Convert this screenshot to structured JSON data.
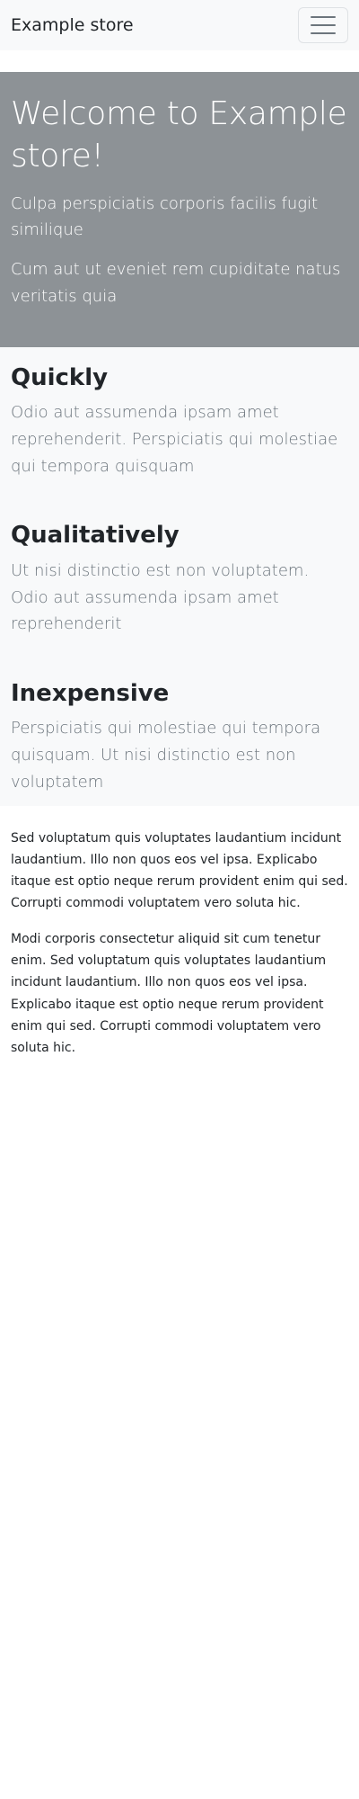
{
  "navbar": {
    "brand": "Example store",
    "toggle_icon": "hamburger-menu-icon"
  },
  "hero": {
    "title": "Welcome to Example store!",
    "paragraphs": [
      "Culpa perspiciatis corporis facilis fugit similique",
      "Cum aut ut eveniet rem cupiditate natus veritatis quia"
    ]
  },
  "features": [
    {
      "title": "Quickly",
      "text": "Odio aut assumenda ipsam amet reprehenderit. Perspiciatis qui molestiae qui tempora quisquam"
    },
    {
      "title": "Qualitatively",
      "text": "Ut nisi distinctio est non voluptatem. Odio aut assumenda ipsam amet reprehenderit"
    },
    {
      "title": "Inexpensive",
      "text": "Perspiciatis qui molestiae qui tempora quisquam. Ut nisi distinctio est non voluptatem"
    }
  ],
  "content": {
    "paragraphs": [
      "Sed voluptatum quis voluptates laudantium incidunt laudantium. Illo non quos eos vel ipsa. Explicabo itaque est optio neque rerum provident enim qui sed. Corrupti commodi voluptatem vero soluta hic.",
      "Modi corporis consectetur aliquid sit cum tenetur enim. Sed voluptatum quis voluptates laudantium incidunt laudantium. Illo non quos eos vel ipsa. Explicabo itaque est optio neque rerum provident enim qui sed. Corrupti commodi voluptatem vero soluta hic."
    ]
  },
  "colors": {
    "navbar_bg": "#f8f9fa",
    "hero_bg": "#8d9296",
    "features_bg": "#f8f9fa",
    "muted_text": "#6c757d",
    "body_text": "#212529"
  }
}
